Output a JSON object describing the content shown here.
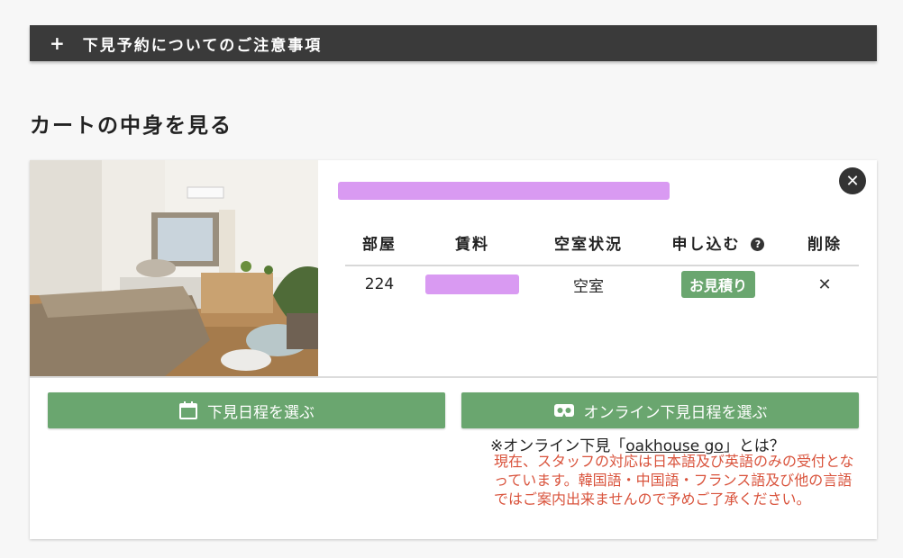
{
  "notice": {
    "icon": "plus-icon",
    "plus": "+",
    "label": "下見予約についてのご注意事項"
  },
  "section_title": "カートの中身を見る",
  "table": {
    "headers": {
      "room": "部屋",
      "rent": "賃料",
      "status": "空室状況",
      "apply": "申し込む",
      "delete": "削除"
    },
    "row": {
      "room": "224",
      "status": "空室",
      "quote": "お見積り",
      "delete": "✕"
    }
  },
  "close_glyph": "✕",
  "help_glyph": "?",
  "buttons": {
    "schedule": {
      "label": "下見日程を選ぶ",
      "icon": "calendar-icon"
    },
    "online": {
      "label": "オンライン下見日程を選ぶ",
      "icon": "vr-headset-icon"
    }
  },
  "online_note": {
    "prefix": "※オンライン下見「",
    "link": "oakhouse go",
    "suffix": "」とは？"
  },
  "online_warning": "現在、スタッフの対応は日本語及び英語のみの受付となっています。韓国語・中国語・フランス語及び他の言語ではご案内出来ませんので予めご了承ください。",
  "colors": {
    "green": "#6aa66f",
    "dark": "#3a3a3a",
    "warning": "#d9533c",
    "redaction": "#d99af2"
  }
}
